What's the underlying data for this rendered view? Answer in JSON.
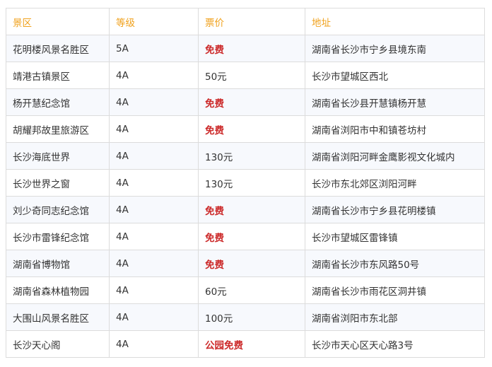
{
  "table": {
    "headers": [
      "景区",
      "等级",
      "票价",
      "地址"
    ],
    "rows": [
      [
        "花明楼风景名胜区",
        "5A",
        "免费",
        "湖南省长沙市宁乡县境东南"
      ],
      [
        "靖港古镇景区",
        "4A",
        "50元",
        "长沙市望城区西北"
      ],
      [
        "杨开慧纪念馆",
        "4A",
        "免费",
        "湖南省长沙县开慧镇杨开慧"
      ],
      [
        "胡耀邦故里旅游区",
        "4A",
        "免费",
        "湖南省浏阳市中和镇苍坊村"
      ],
      [
        "长沙海底世界",
        "4A",
        "130元",
        "湖南省浏阳河畔金鹰影视文化城内"
      ],
      [
        "长沙世界之窗",
        "4A",
        "130元",
        "长沙市东北郊区浏阳河畔"
      ],
      [
        "刘少奇同志纪念馆",
        "4A",
        "免费",
        "湖南省长沙市宁乡县花明楼镇"
      ],
      [
        "长沙市雷锋纪念馆",
        "4A",
        "免费",
        "长沙市望城区雷锋镇"
      ],
      [
        "湖南省博物馆",
        "4A",
        "免费",
        "湖南省长沙市东风路50号"
      ],
      [
        "湖南省森林植物园",
        "4A",
        "60元",
        "湖南省长沙市雨花区洞井镇"
      ],
      [
        "大围山风景名胜区",
        "4A",
        "100元",
        "湖南省浏阳市东北部"
      ],
      [
        "长沙天心阁",
        "4A",
        "公园免费",
        "长沙市天心区天心路3号"
      ]
    ],
    "highlight_price_color": "#cc2a2a",
    "header_color": "#f0a21e"
  }
}
